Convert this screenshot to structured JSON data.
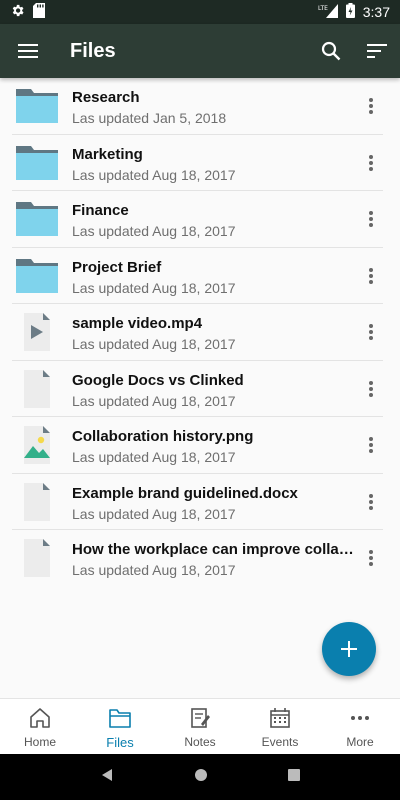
{
  "statusbar": {
    "time": "3:37",
    "network": "LTE"
  },
  "appbar": {
    "title": "Files"
  },
  "files": [
    {
      "name": "Research",
      "updated": "Las updated Jan 5, 2018",
      "kind": "folder"
    },
    {
      "name": "Marketing",
      "updated": "Las updated Aug 18, 2017",
      "kind": "folder"
    },
    {
      "name": "Finance",
      "updated": "Las updated Aug 18, 2017",
      "kind": "folder"
    },
    {
      "name": "Project Brief",
      "updated": "Las updated Aug 18, 2017",
      "kind": "folder"
    },
    {
      "name": "sample video.mp4",
      "updated": "Las updated Aug 18, 2017",
      "kind": "video"
    },
    {
      "name": "Google Docs vs Clinked",
      "updated": "Las updated Aug 18, 2017",
      "kind": "doc"
    },
    {
      "name": "Collaboration history.png",
      "updated": "Las updated Aug 18, 2017",
      "kind": "image"
    },
    {
      "name": "Example brand guidelined.docx",
      "updated": "Las updated Aug 18, 2017",
      "kind": "doc"
    },
    {
      "name": "How the workplace can improve collab…",
      "updated": "Las updated Aug 18, 2017",
      "kind": "doc"
    }
  ],
  "bottomnav": [
    {
      "label": "Home",
      "icon": "home-icon"
    },
    {
      "label": "Files",
      "icon": "folder-icon",
      "active": true
    },
    {
      "label": "Notes",
      "icon": "notes-icon"
    },
    {
      "label": "Events",
      "icon": "calendar-icon"
    },
    {
      "label": "More",
      "icon": "more-horizontal-icon"
    }
  ],
  "colors": {
    "appbar": "#2d3d35",
    "statusbar": "#1e2a24",
    "accent": "#0a7fae",
    "folder": "#7fd3ec",
    "folder_tab": "#5f7783"
  }
}
